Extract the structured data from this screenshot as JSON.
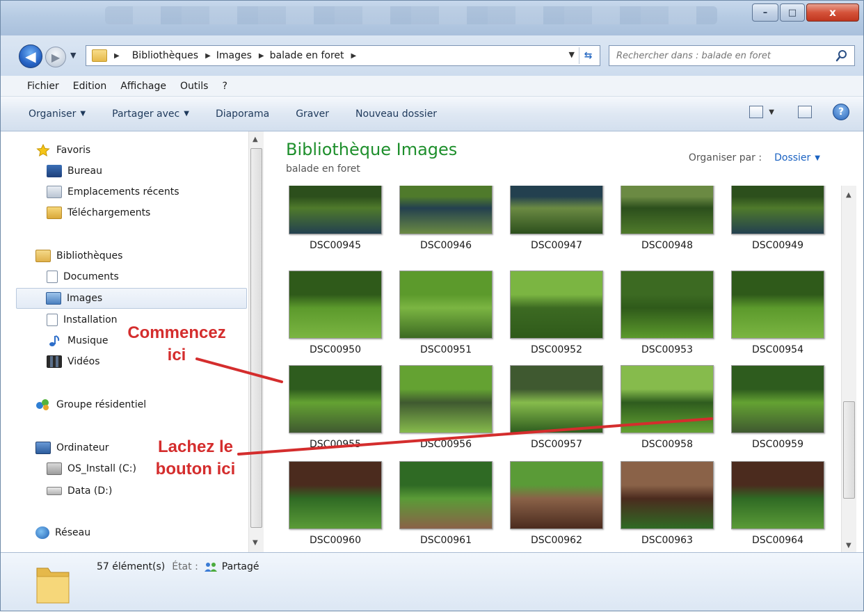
{
  "window": {
    "controls": {
      "minimize": "–",
      "maximize": "□",
      "close": "x"
    }
  },
  "address": {
    "crumbs": [
      "Bibliothèques",
      "Images",
      "balade en foret"
    ],
    "search_placeholder": "Rechercher dans : balade en foret"
  },
  "menu": [
    "Fichier",
    "Edition",
    "Affichage",
    "Outils",
    "?"
  ],
  "toolbar": {
    "organiser": "Organiser",
    "partager": "Partager avec",
    "diaporama": "Diaporama",
    "graver": "Graver",
    "nouveau_dossier": "Nouveau dossier",
    "help": "?"
  },
  "nav": {
    "favoris": "Favoris",
    "bureau": "Bureau",
    "emplacements": "Emplacements récents",
    "telechargements": "Téléchargements",
    "bibliotheques": "Bibliothèques",
    "documents": "Documents",
    "images": "Images",
    "installation": "Installation",
    "musique": "Musique",
    "videos": "Vidéos",
    "groupe": "Groupe résidentiel",
    "ordinateur": "Ordinateur",
    "os_install": "OS_Install (C:)",
    "data": "Data (D:)",
    "reseau": "Réseau"
  },
  "content": {
    "title": "Bibliothèque Images",
    "subtitle": "balade en foret",
    "arrange_label": "Organiser par :",
    "arrange_value": "Dossier",
    "thumbnails": [
      [
        "DSC00945",
        "DSC00946",
        "DSC00947",
        "DSC00948",
        "DSC00949"
      ],
      [
        "DSC00950",
        "DSC00951",
        "DSC00952",
        "DSC00953",
        "DSC00954"
      ],
      [
        "DSC00955",
        "DSC00956",
        "DSC00957",
        "DSC00958",
        "DSC00959"
      ],
      [
        "DSC00960",
        "DSC00961",
        "DSC00962",
        "DSC00963",
        "DSC00964"
      ]
    ]
  },
  "details": {
    "count": "57 élément(s)",
    "state_label": "État :",
    "state_value": "Partagé"
  },
  "annotations": {
    "start_line1": "Commencez",
    "start_line2": "ici",
    "end_line1": "Lachez le",
    "end_line2": "bouton ici"
  },
  "colors": {
    "annotation": "#d42d2d",
    "library_title": "#1e8f2c",
    "link": "#1a62c2"
  }
}
